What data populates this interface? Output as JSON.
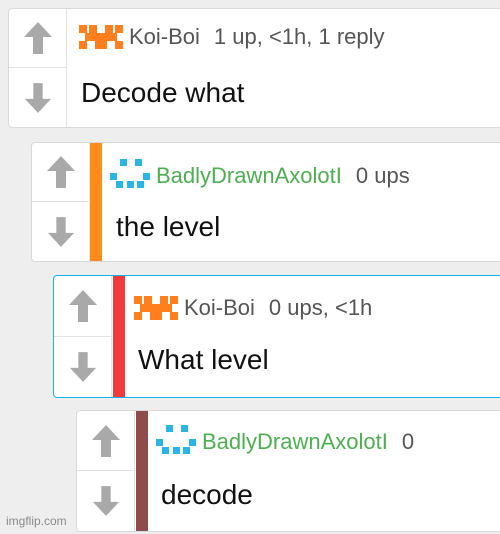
{
  "comments": [
    {
      "username": "Koi-Boi",
      "meta": "1 up, <1h, 1 reply",
      "text": "Decode what",
      "user_color": "#555555",
      "bar_color": null,
      "avatar": "orange-pixel-avatar-icon"
    },
    {
      "username": "BadlyDrawnAxolotI",
      "meta": "0 ups",
      "text": "the level",
      "user_color": "#4caf50",
      "bar_color": "#ff8c1a",
      "avatar": "blue-pixel-avatar-icon"
    },
    {
      "username": "Koi-Boi",
      "meta": "0 ups, <1h",
      "text": "What level",
      "user_color": "#555555",
      "bar_color": "#ef3b3b",
      "avatar": "orange-pixel-avatar-icon"
    },
    {
      "username": "BadlyDrawnAxolotI",
      "meta": "0",
      "text": "decode",
      "user_color": "#4caf50",
      "bar_color": "#8e4c4c",
      "avatar": "blue-pixel-avatar-icon"
    }
  ],
  "icons": {
    "upvote": "up-arrow-icon",
    "downvote": "down-arrow-icon"
  },
  "colors": {
    "vote_arrow": "#a9a9a9",
    "active_border": "#1ab2e8",
    "orange_avatar": "#ff7f1f",
    "blue_avatar": "#29b6e6"
  },
  "watermark": "imgflip.com"
}
